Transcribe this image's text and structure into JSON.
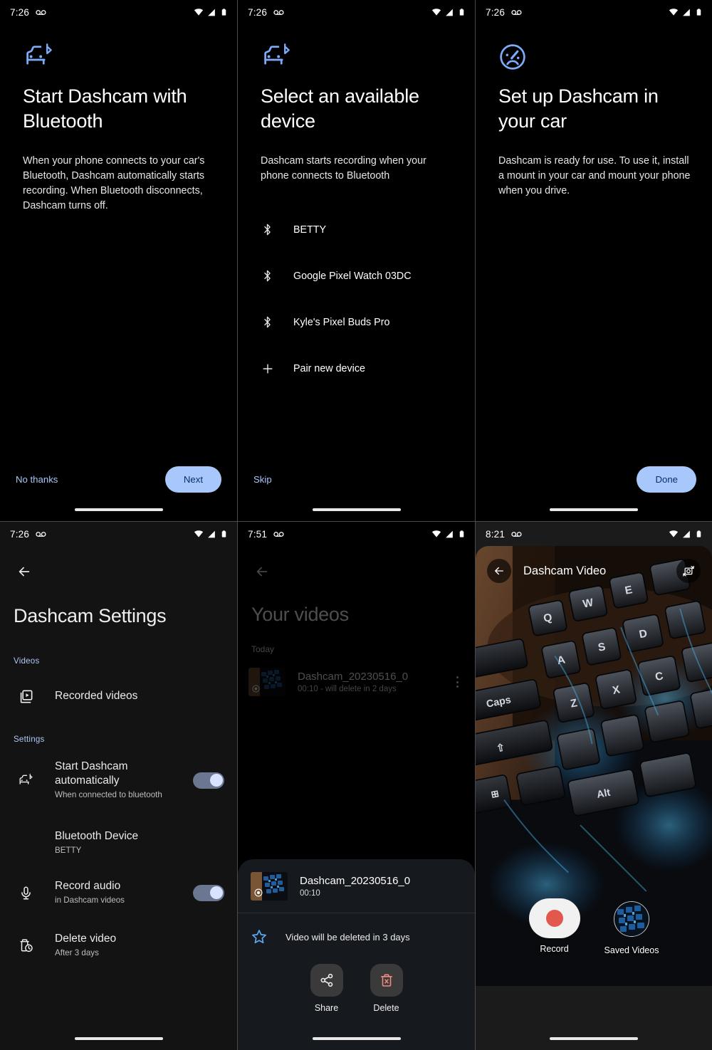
{
  "accent": {
    "blue": "#a8c7fa",
    "blue_icon": "#7cacf8",
    "on_blue": "#062e6f",
    "record_red": "#e2584d",
    "delete_red": "#f28b82",
    "star_blue": "#5aa9f0"
  },
  "status_bar": {
    "time_1": "7:26",
    "time_2": "7:26",
    "time_3": "7:26",
    "time_4": "7:26",
    "time_5": "7:51",
    "time_6": "8:21",
    "voicemail_icon": "voicemail-icon",
    "wifi_icon": "wifi-icon",
    "signal_icon": "cell-signal-icon",
    "battery_icon": "battery-icon"
  },
  "screen1": {
    "icon": "car-bluetooth-icon",
    "title": "Start Dashcam with Bluetooth",
    "body": "When your phone connects to your car's Bluetooth, Dashcam automatically starts recording. When Bluetooth disconnects, Dashcam turns off.",
    "secondary_button": "No thanks",
    "primary_button": "Next"
  },
  "screen2": {
    "icon": "car-bluetooth-icon",
    "title": "Select an available device",
    "body": "Dashcam starts recording when your phone connects to Bluetooth",
    "devices": [
      {
        "label": "BETTY",
        "icon": "bluetooth-icon"
      },
      {
        "label": "Google Pixel Watch 03DC",
        "icon": "bluetooth-icon"
      },
      {
        "label": "Kyle's Pixel Buds Pro",
        "icon": "bluetooth-icon"
      },
      {
        "label": "Pair new device",
        "icon": "plus-icon"
      }
    ],
    "secondary_button": "Skip"
  },
  "screen3": {
    "icon": "speedometer-icon",
    "title": "Set up Dashcam in your car",
    "body": "Dashcam is ready for use. To use it, install a mount in your car and mount your phone when you drive.",
    "primary_button": "Done"
  },
  "screen4": {
    "back_icon": "back-arrow-icon",
    "title": "Dashcam Settings",
    "section_videos": "Videos",
    "section_settings": "Settings",
    "rows": [
      {
        "icon": "video-library-icon",
        "title": "Recorded videos",
        "subtitle": "",
        "toggle": null
      },
      {
        "icon": "car-bluetooth-icon",
        "title": "Start Dashcam automatically",
        "subtitle": "When connected to bluetooth",
        "toggle": "on"
      },
      {
        "icon": "",
        "title": "Bluetooth Device",
        "subtitle": "BETTY",
        "toggle": null
      },
      {
        "icon": "microphone-icon",
        "title": "Record audio",
        "subtitle": "in Dashcam videos",
        "toggle": "on"
      },
      {
        "icon": "delete-clock-icon",
        "title": "Delete video",
        "subtitle": "After 3 days",
        "toggle": null
      }
    ]
  },
  "screen5": {
    "back_icon": "back-arrow-icon",
    "title": "Your videos",
    "group_label": "Today",
    "video": {
      "name": "Dashcam_20230516_0",
      "meta": "00:10 - will delete in 2 days",
      "kebab_icon": "more-options-icon"
    },
    "sheet": {
      "name": "Dashcam_20230516_0",
      "duration": "00:10",
      "star_icon": "star-outline-icon",
      "notice": "Video will be deleted in 3 days",
      "actions": [
        {
          "label": "Share",
          "icon": "share-icon"
        },
        {
          "label": "Delete",
          "icon": "delete-icon"
        }
      ]
    }
  },
  "screen6": {
    "back_icon": "back-arrow-icon",
    "title": "Dashcam Video",
    "flip_icon": "camera-flip-icon",
    "record_label": "Record",
    "saved_label": "Saved Videos",
    "record_icon": "record-dot-icon",
    "saved_icon": "saved-videos-thumbnail"
  }
}
